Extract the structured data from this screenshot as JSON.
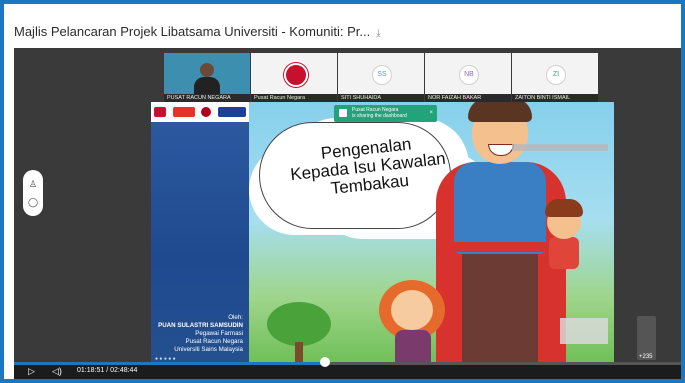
{
  "window": {
    "title": "Majlis Pelancaran Projek Libatsama Universiti - Komuniti: Pr...",
    "download_icon": "download-icon"
  },
  "participants": [
    {
      "label": "PUSAT RACUN NEGARA",
      "kind": "camera"
    },
    {
      "label": "Pusat Racun Negara",
      "kind": "logo"
    },
    {
      "label": "SITI SHUHAIDA",
      "kind": "initials",
      "initials": "SS"
    },
    {
      "label": "NOR FAIZAH BAKAR",
      "kind": "initials",
      "initials": "NB"
    },
    {
      "label": "ZAITON BINTI ISMAIL",
      "kind": "initials",
      "initials": "ZI"
    }
  ],
  "toast": {
    "line1": "Pusat Racun Negara",
    "line2": "is sharing the dashboard"
  },
  "slide": {
    "title_line1": "Pengenalan",
    "title_line2": "Kepada Isu Kawalan",
    "title_line3": "Tembakau",
    "by_label": "Oleh:",
    "presenter": "PUAN SULASTRI SAMSUDIN",
    "role": "Pegawai Farmasi",
    "org": "Pusat Racun Negara",
    "university": "Universiti Sains Malaysia"
  },
  "overlay": {
    "participant_count": "+235"
  },
  "playback": {
    "current_time": "01:18:51",
    "total_time": "02:48:44",
    "time_display": "01:18:51 / 02:48:44",
    "progress_fraction": 0.467
  },
  "colors": {
    "frame_border": "#1a78c2",
    "toast": "#22a37a",
    "progress": "#1a78c2"
  }
}
